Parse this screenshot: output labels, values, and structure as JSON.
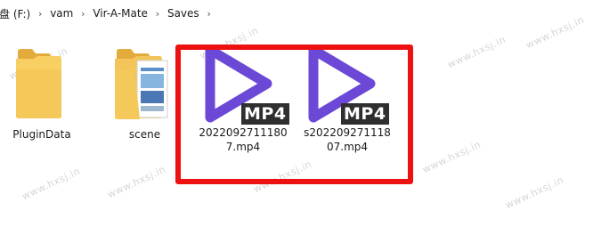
{
  "breadcrumb": {
    "drive": "盘 (F:)",
    "items": [
      "vam",
      "Vir-A-Mate",
      "Saves"
    ]
  },
  "files": [
    {
      "name": "PluginData",
      "type": "folder"
    },
    {
      "name": "scene",
      "type": "folder"
    },
    {
      "name_line1": "2022092711180",
      "name_line2": "7.mp4",
      "type": "video",
      "badge": "MP4"
    },
    {
      "name_line1": "s202209271118",
      "name_line2": "07.mp4",
      "type": "video",
      "badge": "MP4"
    }
  ],
  "watermark": "www.hxsj.in",
  "colors": {
    "play_icon": "#6b48d6",
    "highlight": "#ee1111",
    "folder": "#f5c85a",
    "badge_bg": "#2f2f2f"
  }
}
